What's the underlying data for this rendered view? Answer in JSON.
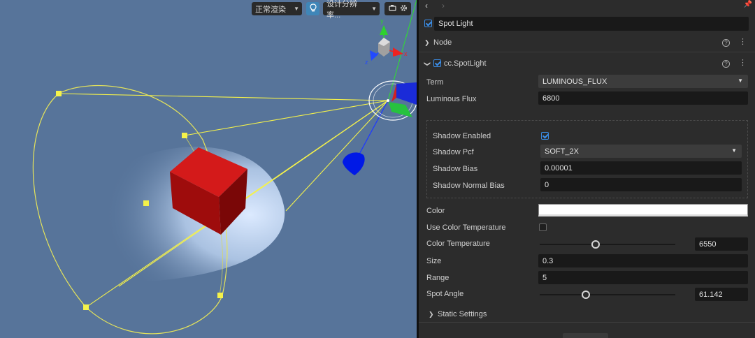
{
  "scene_toolbar": {
    "render_mode": "正常渲染",
    "resolution": "设计分辨率...",
    "icons": [
      "chevron-down-icon",
      "lightbulb-icon",
      "camera-icon",
      "gear-icon"
    ]
  },
  "colors": {
    "scene_bg": "#57749a",
    "inspector_bg": "#2c2c2c",
    "accent": "#3b8ee8",
    "gizmo_yellow": "#f5f24a",
    "cube_red": "#c21212"
  },
  "inspector": {
    "node_name": "Spot Light",
    "node_section": "Node",
    "component": {
      "name": "cc.SpotLight",
      "term_label": "Term",
      "term_value": "LUMINOUS_FLUX",
      "flux_label": "Luminous Flux",
      "flux_value": "6800",
      "shadow": {
        "enabled_label": "Shadow Enabled",
        "enabled": true,
        "pcf_label": "Shadow Pcf",
        "pcf_value": "SOFT_2X",
        "bias_label": "Shadow Bias",
        "bias_value": "0.00001",
        "normal_bias_label": "Shadow Normal Bias",
        "normal_bias_value": "0"
      },
      "color_label": "Color",
      "color_value": "#ffffff",
      "use_temp_label": "Use Color Temperature",
      "use_temp": false,
      "temp_label": "Color Temperature",
      "temp_value": "6550",
      "temp_fraction": 0.41,
      "size_label": "Size",
      "size_value": "0.3",
      "range_label": "Range",
      "range_value": "5",
      "angle_label": "Spot Angle",
      "angle_value": "61.142",
      "angle_fraction": 0.34
    },
    "static_settings": "Static Settings"
  }
}
